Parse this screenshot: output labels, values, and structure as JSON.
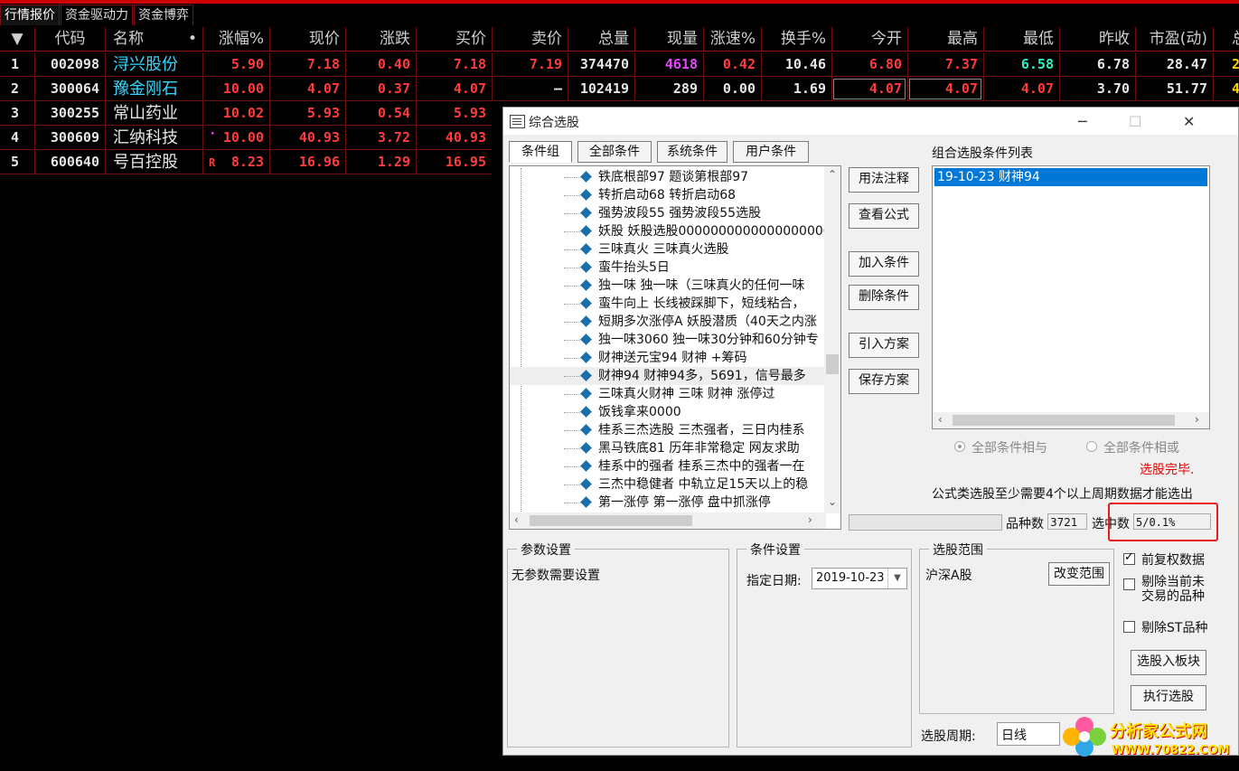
{
  "tabs": [
    "行情报价",
    "资金驱动力",
    "资金博弈"
  ],
  "headers": [
    "▼",
    "代码",
    "名称",
    "•",
    "涨幅%",
    "现价",
    "涨跌",
    "买价",
    "卖价",
    "总量",
    "现量",
    "涨速%",
    "换手%",
    "今开",
    "最高",
    "最低",
    "昨收",
    "市盈(动)",
    "总"
  ],
  "rows": [
    {
      "idx": "1",
      "code": "002098",
      "name": "浔兴股份",
      "flag": "",
      "chg": "5.90",
      "price": "7.18",
      "diff": "0.40",
      "bid": "7.18",
      "ask": "7.19",
      "vol": "374470",
      "cur": "4618",
      "speed": "0.42",
      "turn": "10.46",
      "open": "6.80",
      "high": "7.37",
      "low": "6.58",
      "prev": "6.78",
      "pe": "28.47",
      "extra": "2"
    },
    {
      "idx": "2",
      "code": "300064",
      "name": "豫金刚石",
      "flag": "",
      "chg": "10.00",
      "price": "4.07",
      "diff": "0.37",
      "bid": "4.07",
      "ask": "–",
      "vol": "102419",
      "cur": "289",
      "speed": "0.00",
      "turn": "1.69",
      "open": "4.07",
      "high": "4.07",
      "low": "4.07",
      "prev": "3.70",
      "pe": "51.77",
      "extra": "4"
    },
    {
      "idx": "3",
      "code": "300255",
      "name": "常山药业",
      "flag": "",
      "chg": "10.02",
      "price": "5.93",
      "diff": "0.54",
      "bid": "5.93"
    },
    {
      "idx": "4",
      "code": "300609",
      "name": "汇纳科技",
      "flag": "·",
      "chg": "10.00",
      "price": "40.93",
      "diff": "3.72",
      "bid": "40.93"
    },
    {
      "idx": "5",
      "code": "600640",
      "name": "号百控股",
      "flag": "R",
      "chg": "8.23",
      "price": "16.96",
      "diff": "1.29",
      "bid": "16.95"
    }
  ],
  "dialog": {
    "title": "综合选股",
    "minimize": "─",
    "maximize": "☐",
    "close": "✕",
    "tabs": [
      "条件组",
      "全部条件",
      "系统条件",
      "用户条件"
    ],
    "tree_items": [
      "铁底根部97 题谈第根部97",
      "转折启动68 转折启动68",
      "强势波段55 强势波段55选股",
      "妖股 妖股选股00000000000000000000",
      "三味真火 三味真火选股",
      "蛮牛抬头5日",
      "独一味 独一味（三味真火的任何一味",
      "蛮牛向上 长线被踩脚下，短线粘合，",
      "短期多次涨停A 妖股潜质（40天之内涨",
      "独一味3060 独一味30分钟和60分钟专",
      "财神送元宝94 财神                  +筹码",
      "财神94 财神94多，5691，信号最多",
      "三味真火财神 三味 财神 涨停过",
      "饭钱拿来0000",
      "桂系三杰选股 三杰强者，三日内桂系",
      "黑马铁底81 历年非常稳定  网友求助",
      "桂系中的强者 桂系三杰中的强者一在",
      "三杰中稳健者 中轨立足15天以上的稳",
      "第一涨停 第一涨停    盘中抓涨停"
    ],
    "buttons_mid": [
      "用法注释",
      "查看公式",
      "加入条件",
      "删除条件",
      "引入方案",
      "保存方案"
    ],
    "combo_title": "组合选股条件列表",
    "combo_items": [
      "19-10-23 财神94"
    ],
    "radio_and": "全部条件相与",
    "radio_or": "全部条件相或",
    "status_done": "选股完毕.",
    "notice": "公式类选股至少需要4个以上周期数据才能选出",
    "count_label": "品种数",
    "count_value": "3721",
    "selected_label": "选中数",
    "selected_value": "5/0.1%",
    "param_group": "参数设置",
    "param_text": "无参数需要设置",
    "cond_group": "条件设置",
    "date_label": "指定日期:",
    "date_value": "2019-10-23",
    "range_group": "选股范围",
    "range_value": "沪深A股",
    "range_btn": "改变范围",
    "chk_fq": "前复权数据",
    "chk_tingpai_1": "剔除当前未",
    "chk_tingpai_2": "交易的品种",
    "chk_st": "剔除ST品种",
    "btn_to_block": "选股入板块",
    "btn_run": "执行选股",
    "period_label": "选股周期:",
    "period_value": "日线",
    "watermark_1": "分析家公式网",
    "watermark_2": "WWW.70822.COM",
    "icon_colors": {
      "accent_red": "#e81c1c",
      "select_blue": "#0078d7",
      "done_red": "#e60000"
    }
  }
}
